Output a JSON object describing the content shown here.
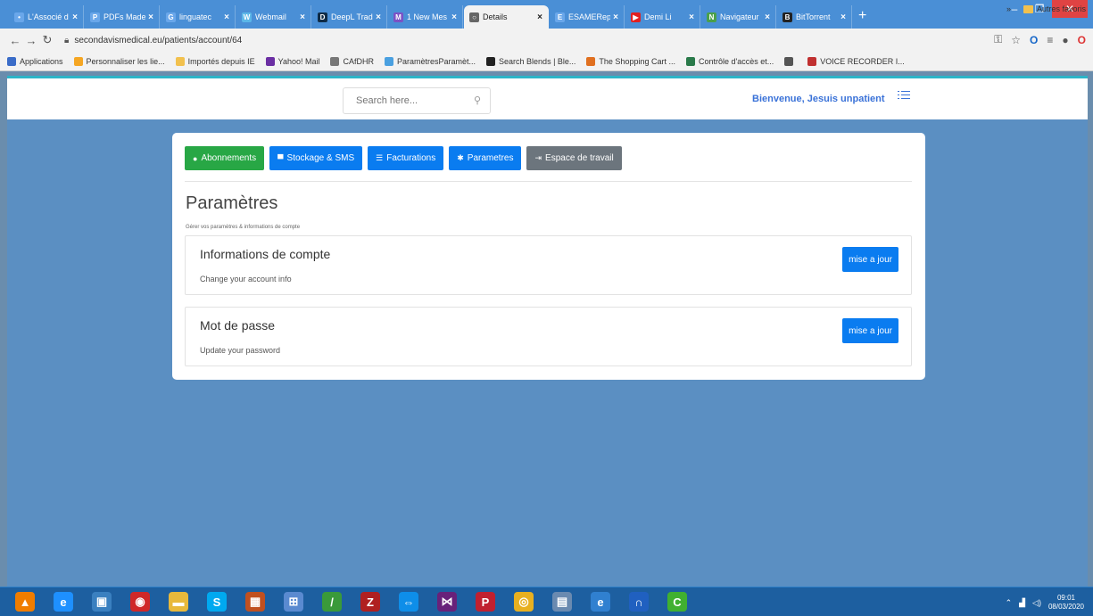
{
  "browser": {
    "tabs": [
      {
        "title": "L'Associé d",
        "color": "#6aa7ea",
        "letter": "•"
      },
      {
        "title": "PDFs Made",
        "color": "#6aa7ea",
        "letter": "P"
      },
      {
        "title": "linguatec",
        "color": "#6aa7ea",
        "letter": "G"
      },
      {
        "title": "Webmail",
        "color": "#5cb7e8",
        "letter": "W"
      },
      {
        "title": "DeepL Trad",
        "color": "#0f2b46",
        "letter": "D"
      },
      {
        "title": "1 New Mes",
        "color": "#7b52c5",
        "letter": "M"
      },
      {
        "title": "Details",
        "color": "#666666",
        "letter": "○"
      },
      {
        "title": "ESAMERep",
        "color": "#6aa7ea",
        "letter": "E"
      },
      {
        "title": "Demi Li",
        "color": "#e02020",
        "letter": "▶"
      },
      {
        "title": "Navigateur",
        "color": "#4aa04a",
        "letter": "N"
      },
      {
        "title": "BitTorrent",
        "color": "#222222",
        "letter": "B"
      }
    ],
    "active_tab_index": 6,
    "new_tab": "+",
    "url": "secondavismedical.eu/patients/account/64",
    "bookmarks": [
      {
        "label": "Applications",
        "color": "#3a6cc8"
      },
      {
        "label": "Personnaliser les lie...",
        "color": "#f5a623"
      },
      {
        "label": "Importés depuis IE",
        "color": "#f2c14e"
      },
      {
        "label": "Yahoo! Mail",
        "color": "#6b2fa3"
      },
      {
        "label": "CAfDHR",
        "color": "#777777"
      },
      {
        "label": "ParamètresParamèt...",
        "color": "#4aa0e0"
      },
      {
        "label": "Search Blends | Ble...",
        "color": "#222222"
      },
      {
        "label": "The Shopping Cart ...",
        "color": "#e07020"
      },
      {
        "label": "Contrôle d'accès et...",
        "color": "#2a7a4a"
      },
      {
        "label": "",
        "color": "#555555"
      },
      {
        "label": "VOICE RECORDER I...",
        "color": "#c03030"
      }
    ],
    "more_bookmarks": "»",
    "other_bookmarks": "Autres favoris"
  },
  "header": {
    "search_placeholder": "Search here...",
    "welcome": "Bienvenue, Jesuis unpatient"
  },
  "tabs": [
    {
      "label": "Abonnements",
      "icon": "●",
      "style": "green"
    },
    {
      "label": "Stockage & SMS",
      "icon": "▀",
      "style": "blue"
    },
    {
      "label": "Facturations",
      "icon": "☰",
      "style": "blue"
    },
    {
      "label": "Parametres",
      "icon": "✱",
      "style": "blue"
    },
    {
      "label": "Espace de travail",
      "icon": "⇥",
      "style": "gray"
    }
  ],
  "main": {
    "title": "Paramètres",
    "subtitle": "Gérer vos paramètres & informations de compte",
    "sections": [
      {
        "title": "Informations de compte",
        "desc": "Change your account info",
        "button": "mise a jour"
      },
      {
        "title": "Mot de passe",
        "desc": "Update your password",
        "button": "mise a jour"
      }
    ]
  },
  "taskbar": {
    "apps": [
      {
        "name": "vlc-icon",
        "color": "#f07d00",
        "glyph": "▲"
      },
      {
        "name": "internet-explorer-icon",
        "color": "#1e90ff",
        "glyph": "e"
      },
      {
        "name": "app-icon",
        "color": "#3a80c0",
        "glyph": "▣"
      },
      {
        "name": "record-icon",
        "color": "#d02828",
        "glyph": "◉"
      },
      {
        "name": "folder-icon",
        "color": "#e8b93c",
        "glyph": "▬"
      },
      {
        "name": "skype-icon",
        "color": "#00a9f0",
        "glyph": "S"
      },
      {
        "name": "calculator-icon",
        "color": "#c05020",
        "glyph": "▦"
      },
      {
        "name": "network-icon",
        "color": "#5a8ad0",
        "glyph": "⊞"
      },
      {
        "name": "brush-icon",
        "color": "#3a9a3a",
        "glyph": "/"
      },
      {
        "name": "filezilla-icon",
        "color": "#b02020",
        "glyph": "Z"
      },
      {
        "name": "teamviewer-icon",
        "color": "#0e8ee9",
        "glyph": "⇔"
      },
      {
        "name": "visual-studio-icon",
        "color": "#68217a",
        "glyph": "⋈"
      },
      {
        "name": "p-icon",
        "color": "#c02030",
        "glyph": "P"
      },
      {
        "name": "chrome-icon",
        "color": "#e8b020",
        "glyph": "◎"
      },
      {
        "name": "notes-icon",
        "color": "#6a8ab0",
        "glyph": "▤"
      },
      {
        "name": "edge-icon",
        "color": "#3080d0",
        "glyph": "e"
      },
      {
        "name": "headphones-icon",
        "color": "#2060c0",
        "glyph": "∩"
      },
      {
        "name": "green-app-icon",
        "color": "#40b030",
        "glyph": "C"
      }
    ],
    "clock_time": "09:01",
    "clock_date": "08/03/2020"
  }
}
